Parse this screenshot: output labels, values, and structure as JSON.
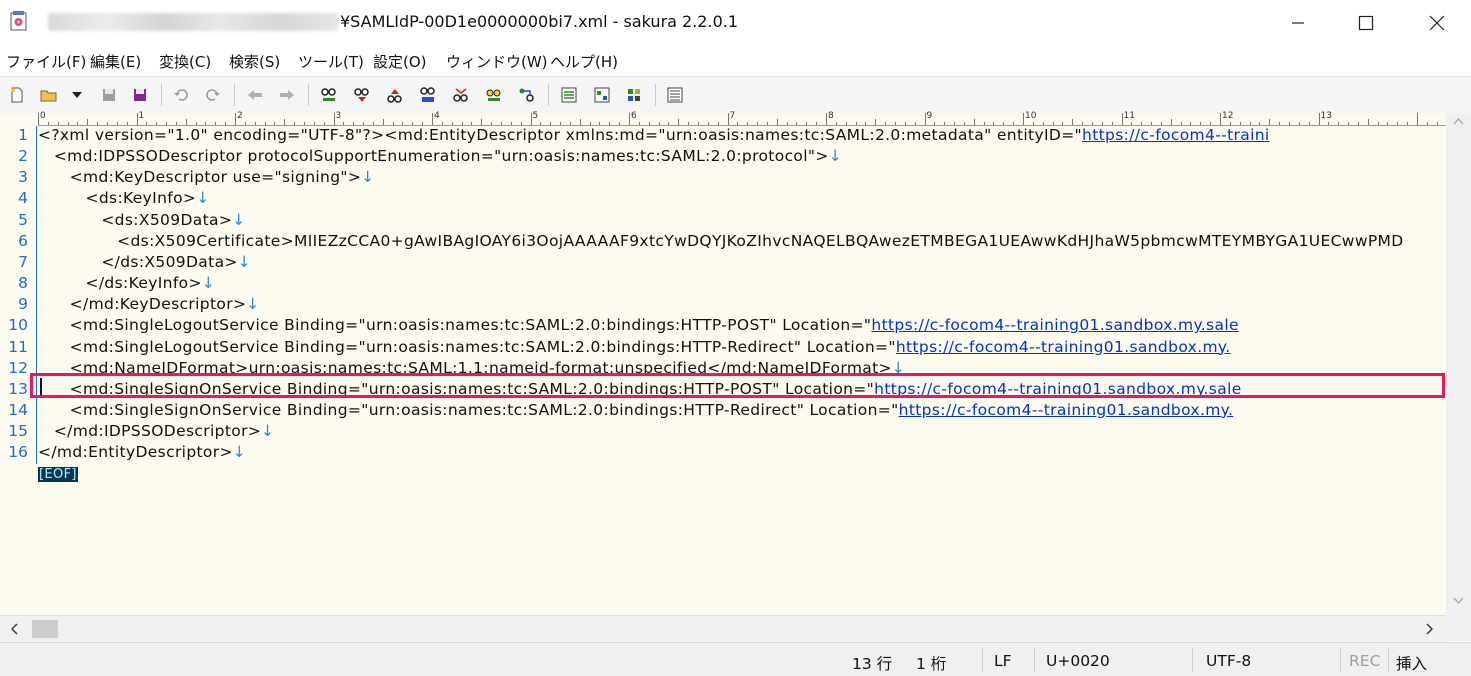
{
  "window": {
    "title": "¥SAMLIdP-00D1e0000000bi7.xml - sakura 2.2.0.1",
    "controls": [
      "minimize-icon",
      "maximize-icon",
      "close-icon"
    ]
  },
  "menu": {
    "items": [
      "ファイル(F)",
      "編集(E)",
      "変換(C)",
      "検索(S)",
      "ツール(T)",
      "設定(O)",
      "ウィンドウ(W)",
      "ヘルプ(H)"
    ]
  },
  "toolbar": {
    "icons": [
      "new-file-icon",
      "open-file-icon",
      "dropdown-icon",
      "save-icon",
      "save-all-icon",
      "undo-icon",
      "redo-icon",
      "jump-back-icon",
      "jump-forward-icon",
      "find-icon",
      "find-next-icon",
      "find-prev-icon",
      "replace-icon",
      "grep-icon",
      "bookmark-icon",
      "tag-jump-icon",
      "outline-icon",
      "settings-icon",
      "type-settings-icon",
      "font-icon"
    ]
  },
  "ruler": {
    "labels": [
      "0",
      "1",
      "2",
      "3",
      "4",
      "5",
      "6",
      "7",
      "8",
      "9",
      "10",
      "11",
      "12",
      "13"
    ]
  },
  "editor": {
    "line_numbers": [
      "1",
      "2",
      "3",
      "4",
      "5",
      "6",
      "7",
      "8",
      "9",
      "10",
      "11",
      "12",
      "13",
      "14",
      "15",
      "16"
    ],
    "lines": [
      {
        "text": "<?xml version=\"1.0\" encoding=\"UTF-8\"?><md:EntityDescriptor xmlns:md=\"urn:oasis:names:tc:SAML:2.0:metadata\" entityID=\"",
        "link": "https://c-focom4--traini",
        "nl": ""
      },
      {
        "text": "   <md:IDPSSODescriptor protocolSupportEnumeration=\"urn:oasis:names:tc:SAML:2.0:protocol\">",
        "link": "",
        "nl": "↓"
      },
      {
        "text": "      <md:KeyDescriptor use=\"signing\">",
        "link": "",
        "nl": "↓"
      },
      {
        "text": "         <ds:KeyInfo>",
        "link": "",
        "nl": "↓"
      },
      {
        "text": "            <ds:X509Data>",
        "link": "",
        "nl": "↓"
      },
      {
        "text": "               <ds:X509Certificate>MIIEZzCCA0+gAwIBAgIOAY6i3OojAAAAAF9xtcYwDQYJKoZIhvcNAQELBQAwezETMBEGA1UEAwwKdHJhaW5pbmcwMTEYMBYGA1UECwwPMD",
        "link": "",
        "nl": ""
      },
      {
        "text": "            </ds:X509Data>",
        "link": "",
        "nl": "↓"
      },
      {
        "text": "         </ds:KeyInfo>",
        "link": "",
        "nl": "↓"
      },
      {
        "text": "      </md:KeyDescriptor>",
        "link": "",
        "nl": "↓"
      },
      {
        "text": "      <md:SingleLogoutService Binding=\"urn:oasis:names:tc:SAML:2.0:bindings:HTTP-POST\" Location=\"",
        "link": "https://c-focom4--training01.sandbox.my.sale",
        "nl": ""
      },
      {
        "text": "      <md:SingleLogoutService Binding=\"urn:oasis:names:tc:SAML:2.0:bindings:HTTP-Redirect\" Location=\"",
        "link": "https://c-focom4--training01.sandbox.my.",
        "nl": ""
      },
      {
        "text": "      <md:NameIDFormat>urn:oasis:names:tc:SAML:1.1:nameid-format:unspecified</md:NameIDFormat>",
        "link": "",
        "nl": "↓"
      },
      {
        "text": "      <md:SingleSignOnService Binding=\"urn:oasis:names:tc:SAML:2.0:bindings:HTTP-POST\" Location=\"",
        "link": "https://c-focom4--training01.sandbox.my.sale",
        "nl": ""
      },
      {
        "text": "      <md:SingleSignOnService Binding=\"urn:oasis:names:tc:SAML:2.0:bindings:HTTP-Redirect\" Location=\"",
        "link": "https://c-focom4--training01.sandbox.my.",
        "nl": ""
      },
      {
        "text": "   </md:IDPSSODescriptor>",
        "link": "",
        "nl": "↓"
      },
      {
        "text": "</md:EntityDescriptor>",
        "link": "",
        "nl": "↓"
      }
    ],
    "eof": "[EOF]",
    "highlighted_line": 13
  },
  "status": {
    "line": "13 行",
    "column": "1 桁",
    "eol": "LF",
    "char_code": "U+0020",
    "encoding": "UTF-8",
    "rec": "REC",
    "mode": "挿入"
  },
  "colors": {
    "editor_bg": "#fdfaf0",
    "line_number": "#1e6ec8",
    "link": "#0033cc",
    "highlight_box": "#e8195e",
    "eof_bg": "#003a52"
  }
}
